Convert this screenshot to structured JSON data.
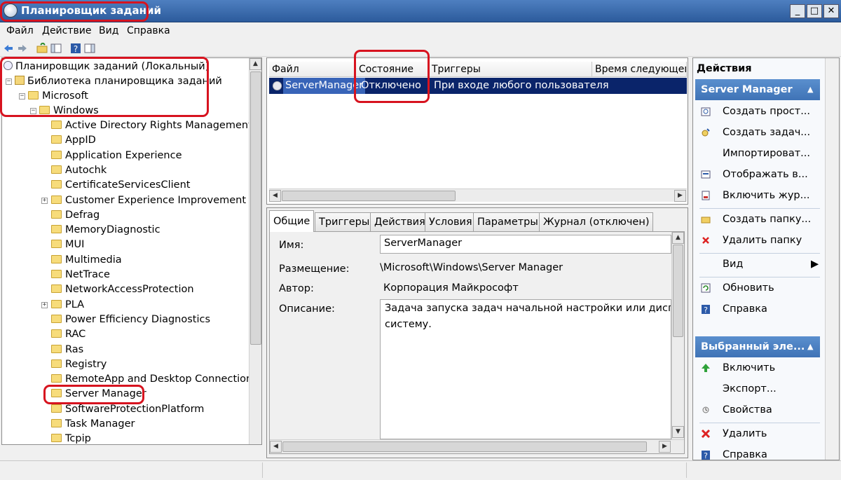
{
  "window": {
    "title": "Планировщик заданий",
    "minimize": "_",
    "maximize": "□",
    "close": "✕"
  },
  "menu": [
    "Файл",
    "Действие",
    "Вид",
    "Справка"
  ],
  "tree": {
    "root": "Планировщик заданий (Локальный)",
    "library": "Библиотека планировщика заданий",
    "microsoft": "Microsoft",
    "windows": "Windows",
    "folders": [
      "Active Directory Rights Management Se",
      "AppID",
      "Application Experience",
      "Autochk",
      "CertificateServicesClient",
      "Customer Experience Improvement Prog",
      "Defrag",
      "MemoryDiagnostic",
      "MUI",
      "Multimedia",
      "NetTrace",
      "NetworkAccessProtection",
      "PLA",
      "Power Efficiency Diagnostics",
      "RAC",
      "Ras",
      "Registry",
      "RemoteApp and Desktop Connections U",
      "Server Manager",
      "SoftwareProtectionPlatform",
      "Task Manager",
      "Tcpip"
    ]
  },
  "tasks": {
    "columns": [
      "Файл",
      "Состояние",
      "Триггеры",
      "Время следующего"
    ],
    "row": {
      "name": "ServerManager",
      "state": "Отключено",
      "trigger": "При входе любого пользователя"
    }
  },
  "details": {
    "tabs": [
      "Общие",
      "Триггеры",
      "Действия",
      "Условия",
      "Параметры",
      "Журнал (отключен)"
    ],
    "name_label": "Имя:",
    "name_value": "ServerManager",
    "location_label": "Размещение:",
    "location_value": "\\Microsoft\\Windows\\Server Manager",
    "author_label": "Автор:",
    "author_value": "Корпорация Майкрософт",
    "description_label": "Описание:",
    "description_line1": "Задача запуска задач начальной настройки или диспетч",
    "description_line2": "систему."
  },
  "actions": {
    "header": "Действия",
    "section1": "Server Manager",
    "items1": [
      {
        "label": "Создать прост...",
        "icon": "create-basic-task-icon"
      },
      {
        "label": "Создать задач...",
        "icon": "create-task-icon"
      },
      {
        "label": "Импортироват...",
        "icon": ""
      },
      {
        "label": "Отображать в...",
        "icon": "display-running-icon"
      },
      {
        "label": "Включить жур...",
        "icon": "enable-history-icon"
      },
      {
        "label": "Создать папку...",
        "icon": "new-folder-icon"
      },
      {
        "label": "Удалить папку",
        "icon": "delete-folder-icon"
      },
      {
        "label": "Вид",
        "icon": ""
      },
      {
        "label": "Обновить",
        "icon": "refresh-icon"
      },
      {
        "label": "Справка",
        "icon": "help-icon"
      }
    ],
    "section2": "Выбранный эле...",
    "items2": [
      {
        "label": "Включить",
        "icon": "enable-icon"
      },
      {
        "label": "Экспорт...",
        "icon": ""
      },
      {
        "label": "Свойства",
        "icon": "properties-icon"
      },
      {
        "label": "Удалить",
        "icon": "delete-icon"
      },
      {
        "label": "Справка",
        "icon": "help-icon"
      }
    ]
  },
  "colors": {
    "highlight": "#d7131f",
    "selection": "#0a246a",
    "section_blue": "#3f73b6"
  }
}
